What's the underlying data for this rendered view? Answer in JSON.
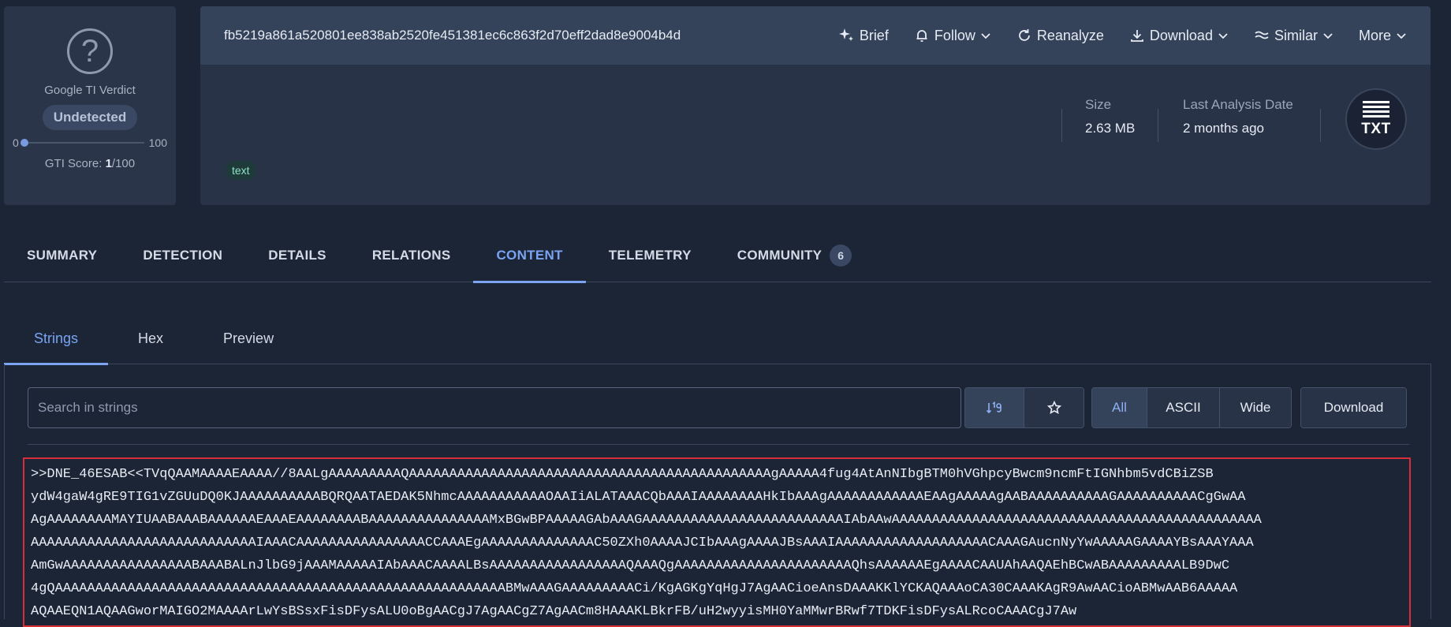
{
  "verdict": {
    "label": "Google TI Verdict",
    "status": "Undetected",
    "scale_min": "0",
    "scale_max": "100",
    "score_prefix": "GTI Score: ",
    "score_value": "1",
    "score_suffix": "/100",
    "score_fraction": 0.01
  },
  "file": {
    "hash": "fb5219a861a520801ee838ab2520fe451381ec6c863f2d70eff2dad8e9004b4d",
    "actions": [
      {
        "label": "Brief",
        "icon": "sparkle-icon"
      },
      {
        "label": "Follow",
        "icon": "bell-icon"
      },
      {
        "label": "Reanalyze",
        "icon": "refresh-icon"
      },
      {
        "label": "Download",
        "icon": "download-icon"
      },
      {
        "label": "Similar",
        "icon": "similar-icon"
      },
      {
        "label": "More",
        "icon": "chevron-down-icon"
      }
    ],
    "size_label": "Size",
    "size_value": "2.63 MB",
    "date_label": "Last Analysis Date",
    "date_value": "2 months ago",
    "type_badge": "TXT",
    "tag": "text"
  },
  "main_tabs": {
    "summary": "SUMMARY",
    "detection": "DETECTION",
    "details": "DETAILS",
    "relations": "RELATIONS",
    "content": "CONTENT",
    "telemetry": "TELEMETRY",
    "community": "COMMUNITY",
    "community_count": "6"
  },
  "sub_tabs": {
    "strings": "Strings",
    "hex": "Hex",
    "preview": "Preview"
  },
  "strings_toolbar": {
    "search_placeholder": "Search in strings",
    "sort_icon": "sort-numeric-icon",
    "star_icon": "star-icon",
    "filter_all": "All",
    "filter_ascii": "ASCII",
    "filter_wide": "Wide",
    "download": "Download"
  },
  "strings": [
    ">>DNE_46ESAB<<TVqQAAMAAAAEAAAA//8AALgAAAAAAAAAQAAAAAAAAAAAAAAAAAAAAAAAAAAAAAAAAAAAAAAAAAAAAAgAAAAA4fug4AtAnNIbgBTM0hVGhpcyBwcm9ncmFtIGNhbm5vdCBiZSB",
    "ydW4gaW4gRE9TIG1vZGUuDQ0KJAAAAAAAAAABQRQAATAEDAK5NhmcAAAAAAAAAAAOAAIiALATAAACQbAAAIAAAAAAAAHkIbAAAgAAAAAAAAAAAAEAAgAAAAAgAABAAAAAAAAAAGAAAAAAAAAACgGwAA",
    "AgAAAAAAAAMAYIUAABAAABAAAAAAEAAAEAAAAAAAABAAAAAAAAAAAAAAAMxBGwBPAAAAAGAbAAAGAAAAAAAAAAAAAAAAAAAAAAAAAIAbAAwAAAAAAAAAAAAAAAAAAAAAAAAAAAAAAAAAAAAAAAAAAAAAA",
    "AAAAAAAAAAAAAAAAAAAAAAAAAAAAIAAACAAAAAAAAAAAAAAAACCAAAEgAAAAAAAAAAAAAAC50ZXh0AAAAJCIbAAAgAAAAJBsAAAIAAAAAAAAAAAAAAAAAAACAAAGAucnNyYwAAAAAGAAAAYBsAAAYAAA",
    "AmGwAAAAAAAAAAAAAAAABAAABALnJlbG9jAAAMAAAAAIAbAAACAAAALBsAAAAAAAAAAAAAAAAAQAAAQgAAAAAAAAAAAAAAAAAAAAAAQhsAAAAAAEgAAAACAAUAhAAQAEhBCwABAAAAAAAAALB9DwC",
    "4gQAAAAAAAAAAAAAAAAAAAAAAAAAAAAAAAAAAAAAAAAAAAAAAAAAAAAAAAABMwAAAGAAAAAAAAACi/KgAGKgYqHgJ7AgAACioeAnsDAAAKKlYCKAQAAAoCA30CAAAKAgR9AwAACioABMwAAB6AAAAA",
    "AQAAEQN1AQAAGworMAIGO2MAAAArLwYsBSsxFisDFysALU0oBgAACgJ7AgAACgZ7AgAACm8HAAAKLBkrFB/uH2wyyisMH0YaMMwrBRwf7TDKFisDFysALRcoCAAACgJ7Aw"
  ]
}
